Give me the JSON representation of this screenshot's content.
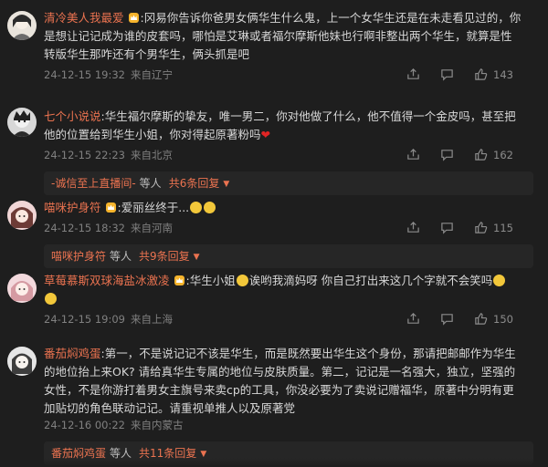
{
  "comments": [
    {
      "username": "清冷美人我最爱",
      "text": ":冈易你告诉你爸男女俩华生什么鬼，上一个女华生还是在未走看见过的，你是想让记记成为谁的皮套吗，哪怕是艾琳或者福尔摩斯他妹也行啊非整出两个华生，就算是性转版华生那咋还有个男华生，俩头抓是吧",
      "date": "24-12-15 19:32",
      "location": "来自辽宁",
      "likes": "143"
    },
    {
      "username": "七个小说说",
      "text": ":华生福尔摩斯的挚友，唯一男二，你对他做了什么，他不值得一个金皮吗，甚至把他的位置给到华生小姐，你对得起原著粉吗",
      "date": "24-12-15 22:23",
      "location": "来自北京",
      "likes": "162",
      "reply": {
        "name": "-诚信至上直播间-",
        "mid": "等人",
        "count": "共6条回复"
      }
    },
    {
      "username": "喵咪护身符",
      "text": ":爱丽丝终于...",
      "date": "24-12-15 18:32",
      "location": "来自河南",
      "likes": "115",
      "reply": {
        "name": "喵咪护身符",
        "mid": "等人",
        "count": "共9条回复"
      }
    },
    {
      "username": "草莓慕斯双球海盐冰激凌",
      "text_a": ":华生小姐",
      "text_b": "诶哟我滴妈呀 你自己打出来这几个字就不会笑吗",
      "date": "24-12-15 19:09",
      "location": "来自上海",
      "likes": "150"
    },
    {
      "username": "番茄焖鸡蛋",
      "text": ":第一，不是说记记不该是华生，而是既然要出华生这个身份，那请把邮邮作为华生的地位抬上来OK? 请给真华生专属的地位与皮肤质量。第二，记记是一名强大，独立，坚强的女性，不是你游打着男女主旗号来卖cp的工具，你没必要为了卖说记赠福华，原著中分明有更加贴切的角色联动记记。请重视单推人以及原著党",
      "date": "24-12-16 00:22",
      "location": "来自内蒙古",
      "likes": "",
      "reply": {
        "name": "番茄焖鸡蛋",
        "mid": "等人",
        "count": "共11条回复"
      }
    }
  ],
  "colors": {
    "accent": "#eb7350",
    "bg": "#1e1e1e",
    "meta": "#808080"
  },
  "icons": [
    "share-icon",
    "comment-icon",
    "like-icon",
    "crown-badge-icon"
  ]
}
